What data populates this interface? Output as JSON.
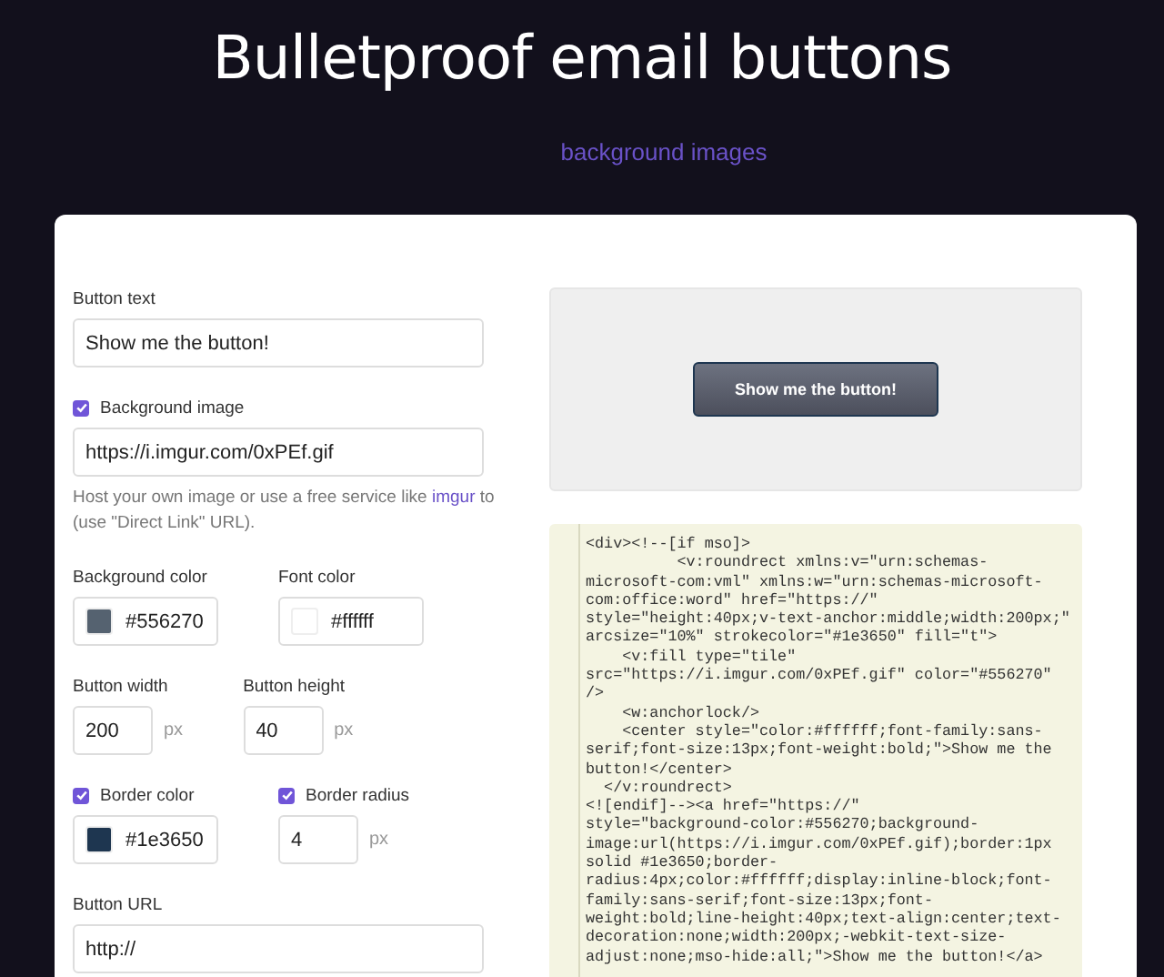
{
  "header": {
    "title": "Bulletproof email buttons",
    "link": "background images"
  },
  "rows": [
    [
      {
        "kind": "text",
        "label": "Button text",
        "value": "Show me the button!"
      }
    ],
    [
      {
        "kind": "text",
        "label": "Background image",
        "checked": true,
        "value": "https://i.imgur.com/0xPEf.gif",
        "help": {
          "before": "Host your own image or use a free service like ",
          "link": "imgur",
          "after": " to (use \"Direct Link\" URL)."
        }
      }
    ],
    [
      {
        "kind": "color",
        "label": "Background color",
        "color": "#556270",
        "value": "#556270"
      },
      {
        "kind": "color",
        "label": "Font color",
        "color": "#ffffff",
        "value": "#ffffff"
      }
    ],
    [
      {
        "kind": "number",
        "label": "Button width",
        "value": "200",
        "unit": "px"
      },
      {
        "kind": "number",
        "label": "Button height",
        "value": "40",
        "unit": "px"
      }
    ],
    [
      {
        "kind": "color",
        "label": "Border color",
        "checked": true,
        "color": "#1e3650",
        "value": "#1e3650"
      },
      {
        "kind": "number",
        "label": "Border radius",
        "checked": true,
        "value": "4",
        "unit": "px"
      }
    ],
    [
      {
        "kind": "text",
        "label": "Button URL",
        "value": "http://"
      }
    ]
  ],
  "preview": {
    "button": "Show me the button!"
  },
  "code": [
    "<div><!--[if mso]>",
    "          <v:roundrect xmlns:v=\"urn:schemas-",
    "microsoft-com:vml\" xmlns:w=\"urn:schemas-microsoft-",
    "com:office:word\" href=\"https://\"",
    "style=\"height:40px;v-text-anchor:middle;width:200px;\"",
    "arcsize=\"10%\" strokecolor=\"#1e3650\" fill=\"t\">",
    "    <v:fill type=\"tile\"",
    "src=\"https://i.imgur.com/0xPEf.gif\" color=\"#556270\"",
    "/>",
    "    <w:anchorlock/>",
    "    <center style=\"color:#ffffff;font-family:sans-",
    "serif;font-size:13px;font-weight:bold;\">Show me the",
    "button!</center>",
    "  </v:roundrect>",
    "<![endif]--><a href=\"https://\"",
    "style=\"background-color:#556270;background-",
    "image:url(https://i.imgur.com/0xPEf.gif);border:1px",
    "solid #1e3650;border-",
    "radius:4px;color:#ffffff;display:inline-block;font-",
    "family:sans-serif;font-size:13px;font-",
    "weight:bold;line-height:40px;text-align:center;text-",
    "decoration:none;width:200px;-webkit-text-size-",
    "adjust:none;mso-hide:all;\">Show me the button!</a>"
  ]
}
